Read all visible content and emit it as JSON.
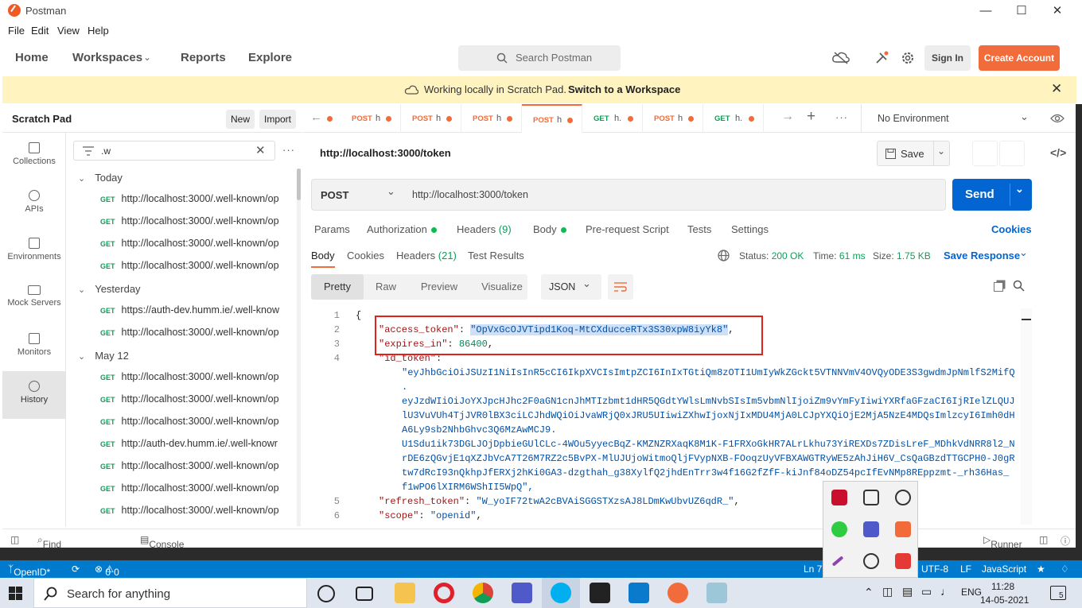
{
  "window": {
    "title": "Postman"
  },
  "menu": [
    "File",
    "Edit",
    "View",
    "Help"
  ],
  "nav": {
    "home": "Home",
    "workspaces": "Workspaces",
    "reports": "Reports",
    "explore": "Explore",
    "search_placeholder": "Search Postman",
    "sign_in": "Sign In",
    "create_account": "Create Account"
  },
  "banner": {
    "text": "Working locally in Scratch Pad.",
    "link": "Switch to a Workspace"
  },
  "scratch": {
    "title": "Scratch Pad",
    "new": "New",
    "import": "Import"
  },
  "sidebar": {
    "items": [
      "Collections",
      "APIs",
      "Environments",
      "Mock Servers",
      "Monitors",
      "History"
    ],
    "filter": ".w",
    "groups": [
      {
        "label": "Today",
        "items": [
          "http://localhost:3000/.well-known/op",
          "http://localhost:3000/.well-known/op",
          "http://localhost:3000/.well-known/op",
          "http://localhost:3000/.well-known/op"
        ]
      },
      {
        "label": "Yesterday",
        "items": [
          "https://auth-dev.humm.ie/.well-know",
          "http://localhost:3000/.well-known/op"
        ]
      },
      {
        "label": "May 12",
        "items": [
          "http://localhost:3000/.well-known/op",
          "http://localhost:3000/.well-known/op",
          "http://localhost:3000/.well-known/op",
          "http://auth-dev.humm.ie/.well-knowr",
          "http://localhost:3000/.well-known/op",
          "http://localhost:3000/.well-known/op",
          "http://localhost:3000/.well-known/op"
        ]
      }
    ],
    "method": "GET"
  },
  "tabs": [
    {
      "method": "POST",
      "name": "h"
    },
    {
      "method": "POST",
      "name": "h"
    },
    {
      "method": "POST",
      "name": "h"
    },
    {
      "method": "POST",
      "name": "h"
    },
    {
      "method": "GET",
      "name": "h."
    },
    {
      "method": "POST",
      "name": "h"
    },
    {
      "method": "GET",
      "name": "h."
    }
  ],
  "environment": "No Environment",
  "request": {
    "title": "http://localhost:3000/token",
    "save": "Save",
    "method": "POST",
    "url": "http://localhost:3000/token",
    "send": "Send"
  },
  "req_tabs": {
    "params": "Params",
    "authorization": "Authorization",
    "headers": "Headers",
    "headers_count": "(9)",
    "body": "Body",
    "prerequest": "Pre-request Script",
    "tests": "Tests",
    "settings": "Settings",
    "cookies": "Cookies"
  },
  "resp_tabs": {
    "body": "Body",
    "cookies": "Cookies",
    "headers": "Headers",
    "headers_count": "(21)",
    "test_results": "Test Results",
    "status_label": "Status:",
    "status": "200 OK",
    "time_label": "Time:",
    "time": "61 ms",
    "size_label": "Size:",
    "size": "1.75 KB",
    "save_response": "Save Response"
  },
  "view_modes": {
    "pretty": "Pretty",
    "raw": "Raw",
    "preview": "Preview",
    "visualize": "Visualize",
    "format": "JSON"
  },
  "code": {
    "line1": "{",
    "access_token_key": "\"access_token\"",
    "access_token_val": "\"OpVxGcOJVTipd1Koq-MtCXducceRTx3S30xpW8iyYk8\"",
    "expires_in_key": "\"expires_in\"",
    "expires_in_val": "86400",
    "id_token_key": "\"id_token\"",
    "id_token_lines": [
      "\"eyJhbGciOiJSUzI1NiIsInR5cCI6IkpXVCIsImtpZCI6InIxTGtiQm8zOTI1UmIyWkZGckt5VTNNVmV4OVQyODE3S3gwdmJpNmlfS2MifQ",
      ".",
      "eyJzdWIiOiJoYXJpcHJhc2F0aGN1cnJhMTIzbmt1dHR5QGdtYWlsLmNvbSIsIm5vbmNlIjoiZm9vYmFyIiwiYXRfaGFzaCI6IjRIelZLQUJ",
      "lU3VuVUh4TjJVR0lBX3ciLCJhdWQiOiJvaWRjQ0xJRU5UIiwiZXhwIjoxNjIxMDU4MjA0LCJpYXQiOjE2MjA5NzE4MDQsImlzcyI6Imh0dH",
      "A6Ly9sb2NhbGhvc3Q6MzAwMCJ9.",
      "U1Sdu1ik73DGLJOjDpbieGUlCLc-4WOu5yyecBqZ-KMZNZRXaqK8M1K-F1FRXoGkHR7ALrLkhu73YiREXDs7ZDisLreF_MDhkVdNRR8l2_N",
      "rDE6zQGvjE1qXZJbVcA7T26M7RZ2c5BvPX-MlUJUjoWitmoQljFVypNXB-FOoqzUyVFBXAWGTRyWE5zAhJiH6V_CsQaGBzdTTGCPH0-J0gR",
      "tw7dRcI93nQkhpJfERXj2hKi0GA3-dzgthah_g38XylfQ2jhdEnTrr3w4f16G2fZfF-kiJnf84oDZ54pcIfEvNMp8REppzmt-_rh36Has_",
      "f1wPO6lXIRM6WShII5WpQ\","
    ],
    "refresh_token_key": "\"refresh_token\"",
    "refresh_token_val": "\"W_yoIF72twA2cBVAiSGGSTXzsAJ8LDmKwUbvUZ6qdR_\"",
    "scope_key": "\"scope\"",
    "scope_val": "\"openid\"",
    "line_numbers": [
      "1",
      "2",
      "3",
      "4",
      "5",
      "6"
    ]
  },
  "bottom": {
    "find_replace": "Find and Replace",
    "console": "Console",
    "runner": "Runner"
  },
  "vscode": {
    "openid": "OpenID*",
    "errors": "0",
    "warnings": "0",
    "ln": "Ln 7",
    "encoding": "UTF-8",
    "eol": "LF",
    "language": "JavaScript"
  },
  "taskbar": {
    "search": "Search for anything",
    "lang": "ENG",
    "time": "11:28",
    "date": "14-05-2021",
    "notif": "5"
  },
  "colors": {
    "accent": "#f26b3a",
    "send": "#0265d2",
    "vsbar": "#007acc",
    "banner": "#fff3bf"
  }
}
